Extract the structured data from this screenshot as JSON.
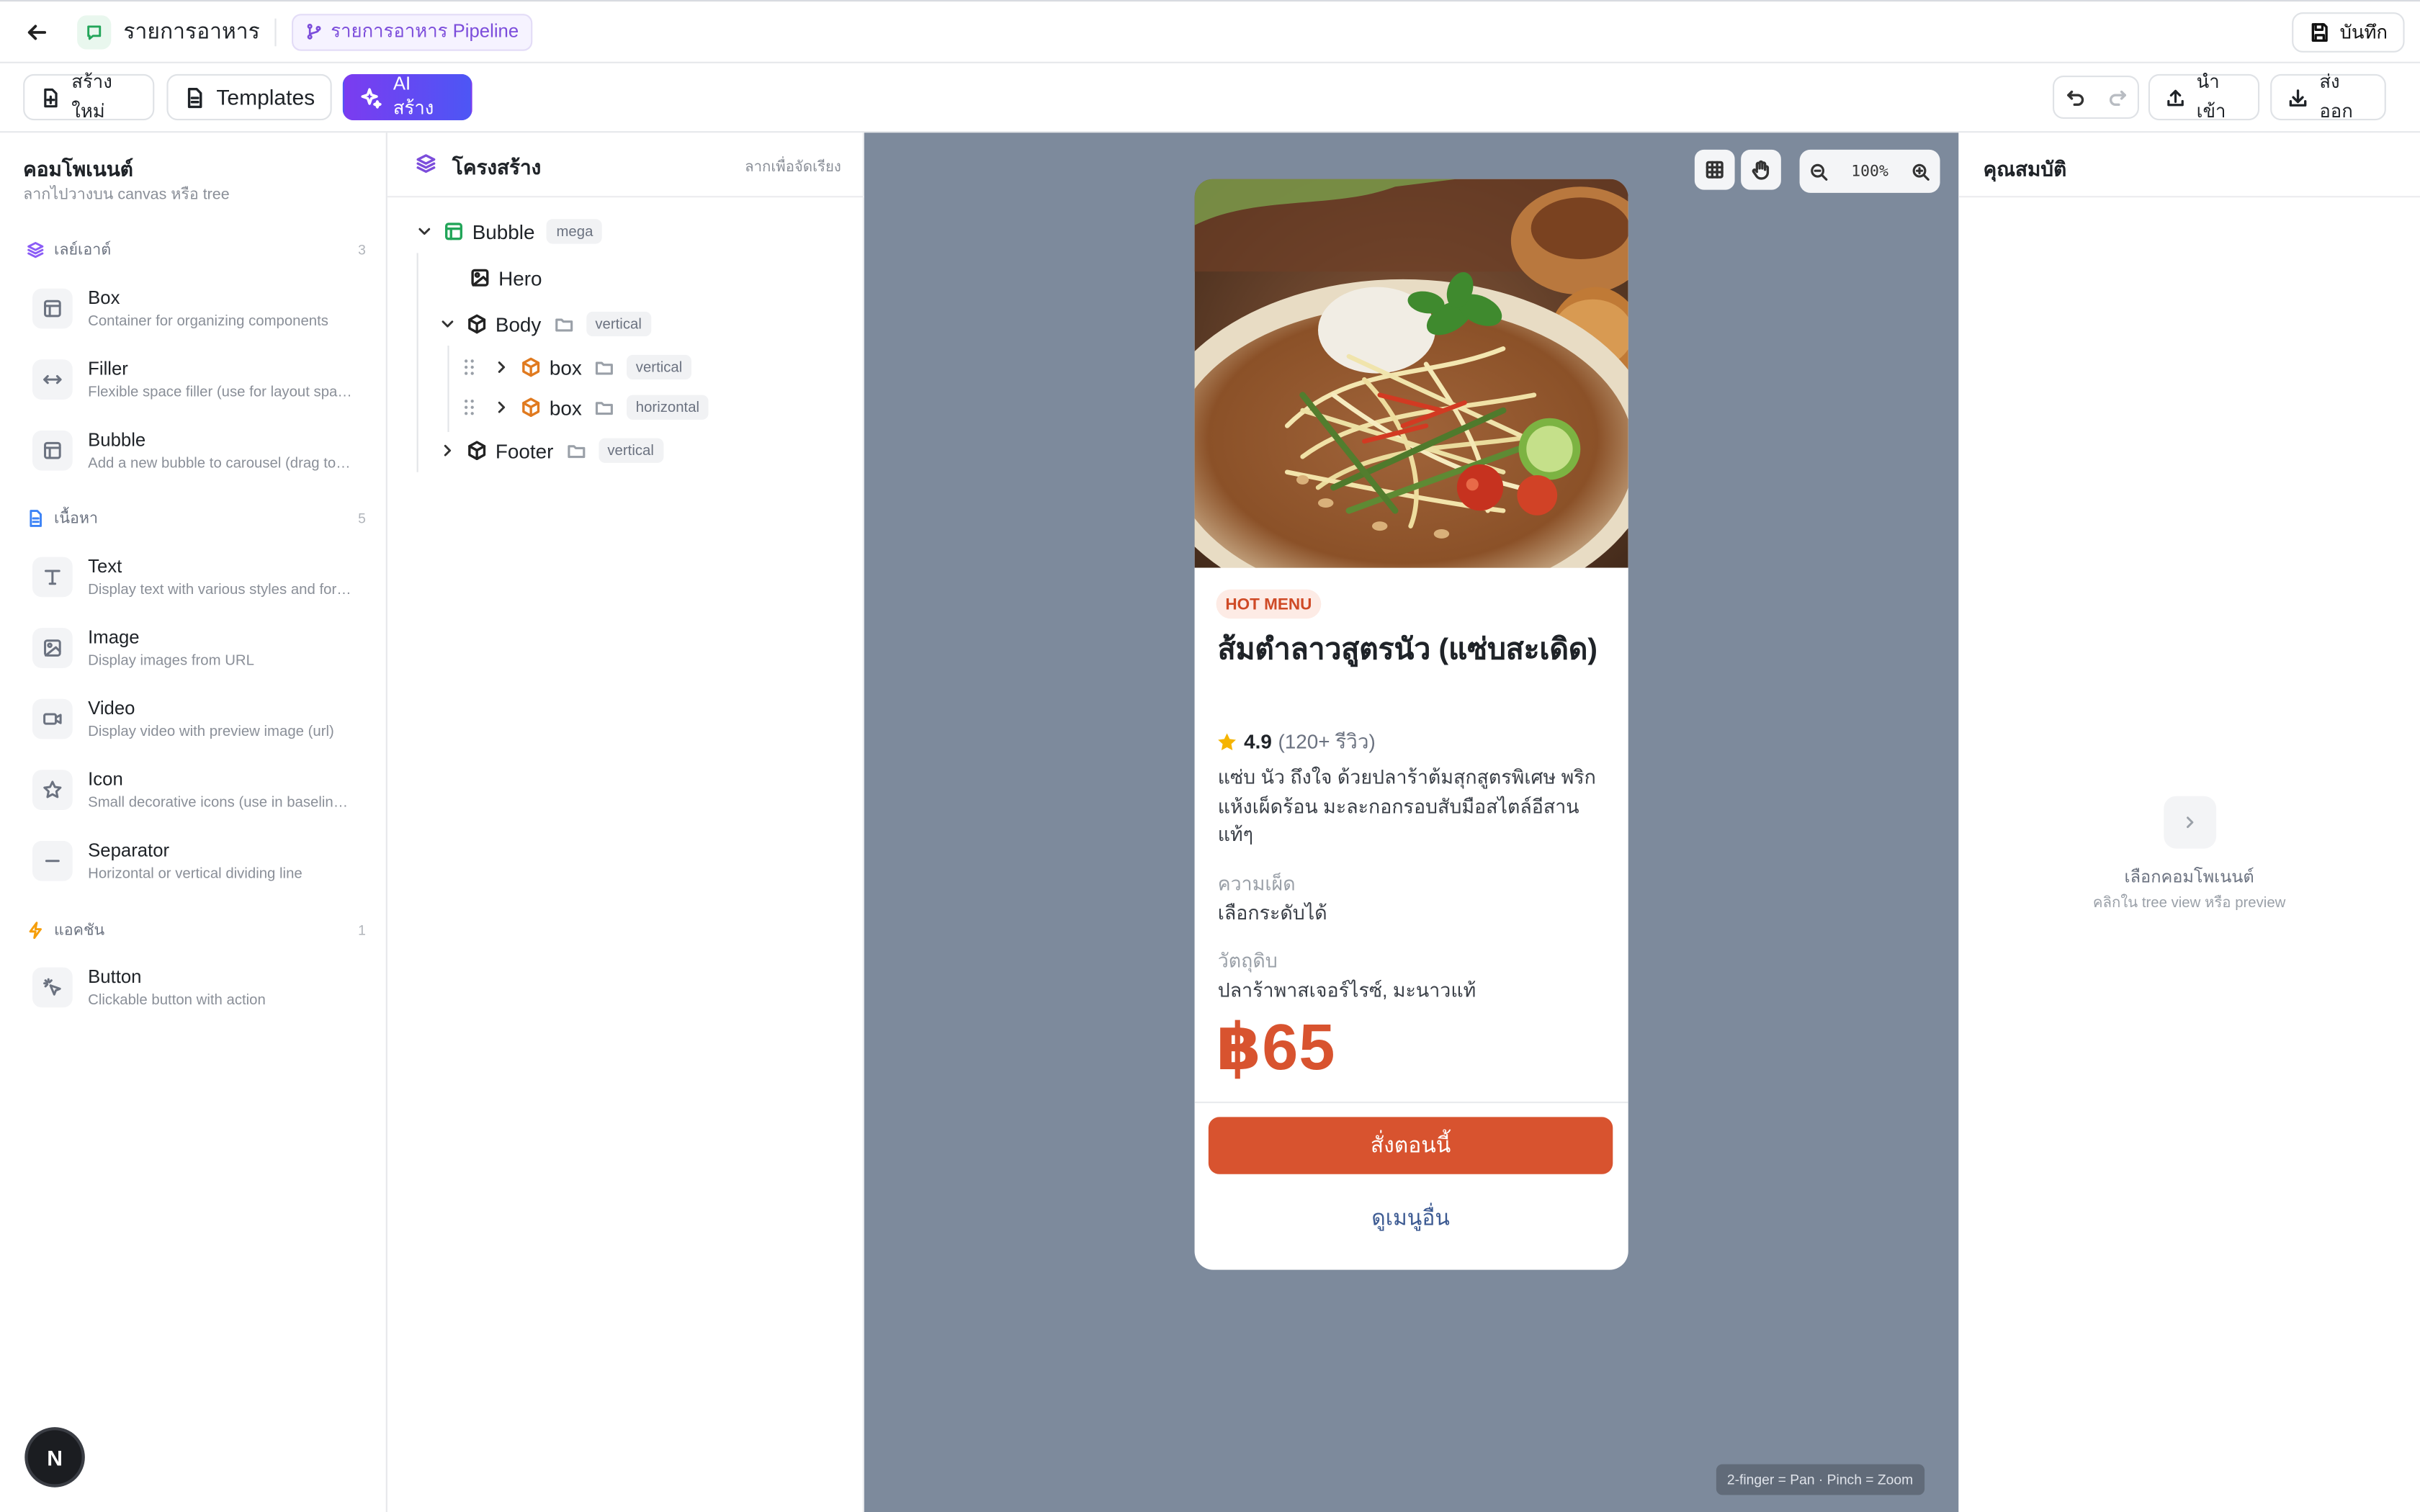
{
  "header": {
    "app_title": "รายการอาหาร",
    "pipeline_label": "รายการอาหาร Pipeline",
    "save_label": "บันทึก"
  },
  "toolbar": {
    "new_label": "สร้างใหม่",
    "templates_label": "Templates",
    "ai_label": "AI สร้าง",
    "import_label": "นำเข้า",
    "export_label": "ส่งออก"
  },
  "components": {
    "title": "คอมโพเนนต์",
    "subtitle": "ลากไปวางบน canvas หรือ tree",
    "groups": [
      {
        "label": "เลย์เอาต์",
        "count": "3",
        "items": [
          {
            "name": "Box",
            "desc": "Container for organizing components"
          },
          {
            "name": "Filler",
            "desc": "Flexible space filler (use for layout spacing)"
          },
          {
            "name": "Bubble",
            "desc": "Add a new bubble to carousel (drag to add)"
          }
        ]
      },
      {
        "label": "เนื้อหา",
        "count": "5",
        "items": [
          {
            "name": "Text",
            "desc": "Display text with various styles and formats"
          },
          {
            "name": "Image",
            "desc": "Display images from URL"
          },
          {
            "name": "Video",
            "desc": "Display video with preview image (url)"
          },
          {
            "name": "Icon",
            "desc": "Small decorative icons (use in baseline box)"
          },
          {
            "name": "Separator",
            "desc": "Horizontal or vertical dividing line"
          }
        ]
      },
      {
        "label": "แอคชัน",
        "count": "1",
        "items": [
          {
            "name": "Button",
            "desc": "Clickable button with action"
          }
        ]
      }
    ]
  },
  "tree": {
    "title": "โครงสร้าง",
    "hint": "ลากเพื่อจัดเรียง",
    "nodes": [
      {
        "label": "Bubble",
        "tag": "mega"
      },
      {
        "label": "Hero",
        "tag": ""
      },
      {
        "label": "Body",
        "tag": "vertical"
      },
      {
        "label": "box",
        "tag": "vertical"
      },
      {
        "label": "box",
        "tag": "horizontal"
      },
      {
        "label": "Footer",
        "tag": "vertical"
      }
    ]
  },
  "canvas": {
    "zoom": "100%",
    "hint": "2-finger = Pan · Pinch = Zoom",
    "card": {
      "badge": "HOT MENU",
      "title": "ส้มตำลาวสูตรนัว (แซ่บสะเดิด)",
      "rating": "4.9",
      "reviews": "(120+ รีวิว)",
      "description": "แซ่บ นัว ถึงใจ ด้วยปลาร้าต้มสุกสูตรพิเศษ พริกแห้งเผ็ดร้อน มะละกอกรอบสับมือสไตล์อีสานแท้ๆ",
      "spicy_label": "ความเผ็ด",
      "spicy_value": "เลือกระดับได้",
      "ingredients_label": "วัตถุดิบ",
      "ingredients_value": "ปลาร้าพาสเจอร์ไรซ์, มะนาวแท้",
      "price": "฿65",
      "order_button": "สั่งตอนนี้",
      "more_button": "ดูเมนูอื่น"
    }
  },
  "properties": {
    "title": "คุณสมบัติ",
    "empty_title": "เลือกคอมโพเนนต์",
    "empty_subtitle": "คลิกใน tree view หรือ preview"
  },
  "next_badge": "N",
  "colors": {
    "accent_purple": "#7b3cf0",
    "accent_orange": "#d8532f",
    "canvas_bg": "#7d8a9c",
    "link_blue": "#3c5a92"
  }
}
